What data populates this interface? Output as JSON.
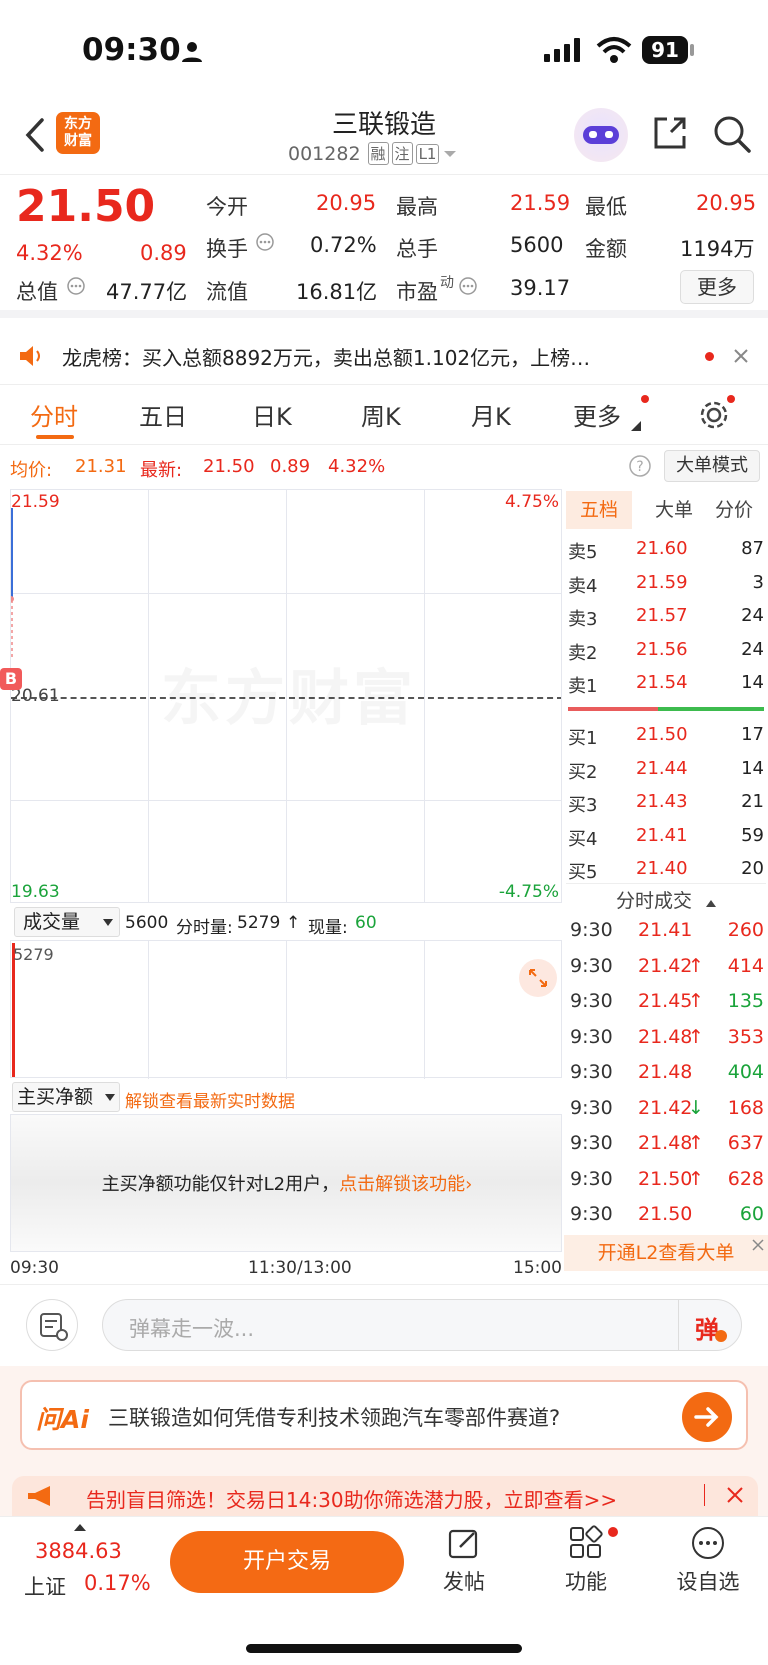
{
  "status_bar": {
    "time": "09:30",
    "battery": "91"
  },
  "header": {
    "logo": "东方\n财富",
    "title": "三联锻造",
    "code": "001282",
    "badges": [
      "融",
      "注",
      "L1"
    ]
  },
  "quote": {
    "price": "21.50",
    "change_pct": "4.32%",
    "change": "0.89",
    "fields": [
      {
        "label": "今开",
        "value": "20.95",
        "color": "red"
      },
      {
        "label": "最高",
        "value": "21.59",
        "color": "red"
      },
      {
        "label": "最低",
        "value": "20.95",
        "color": "red"
      },
      {
        "label": "换手",
        "value": "0.72%",
        "color": "dark"
      },
      {
        "label": "总手",
        "value": "5600",
        "color": "dark"
      },
      {
        "label": "金额",
        "value": "1194万",
        "color": "dark"
      },
      {
        "label": "总值",
        "value": "47.77亿",
        "color": "dark"
      },
      {
        "label": "流值",
        "value": "16.81亿",
        "color": "dark"
      },
      {
        "label": "市盈",
        "value": "39.17",
        "color": "dark"
      }
    ],
    "pe_superscript": "动",
    "more_button": "更多"
  },
  "notice": {
    "text": "龙虎榜：买入总额8892万元，卖出总额1.102亿元，上榜…"
  },
  "tabs": [
    "分时",
    "五日",
    "日K",
    "周K",
    "月K",
    "更多"
  ],
  "active_tab": "分时",
  "chart_header": {
    "avg_label": "均价:",
    "avg_value": "21.31",
    "last_label": "最新:",
    "last_value": "21.50",
    "last_change": "0.89",
    "last_pct": "4.32%",
    "big_order_mode": "大单模式"
  },
  "chart_data": {
    "type": "line",
    "title": "",
    "y_ticks_left": [
      "21.59",
      "20.61",
      "19.63"
    ],
    "y_ticks_right": [
      "4.75%",
      "-4.75%"
    ],
    "x_ticks": [
      "09:30",
      "11:30/13:00",
      "15:00"
    ],
    "ylim": [
      19.63,
      21.59
    ],
    "prev_close": 20.61,
    "series": [
      {
        "x": [
          "09:30"
        ],
        "values": [
          21.5
        ]
      }
    ],
    "watermark": "东方财富",
    "b_marker": "B"
  },
  "volume": {
    "selector": "成交量",
    "total": "5600",
    "minute_label": "分时量:",
    "minute_value": "5279",
    "arrow": "↑",
    "now_label": "现量:",
    "now_value": "60",
    "axis_max": "5279"
  },
  "net_buy": {
    "selector": "主买净额",
    "unlock_hint": "解锁查看最新实时数据",
    "panel_text": "主买净额功能仅针对L2用户，",
    "panel_link": "点击解锁该功能›"
  },
  "orderbook": {
    "tabs": [
      "五档",
      "大单",
      "分价"
    ],
    "asks": [
      {
        "label": "卖5",
        "price": "21.60",
        "vol": "87"
      },
      {
        "label": "卖4",
        "price": "21.59",
        "vol": "3"
      },
      {
        "label": "卖3",
        "price": "21.57",
        "vol": "24"
      },
      {
        "label": "卖2",
        "price": "21.56",
        "vol": "24"
      },
      {
        "label": "卖1",
        "price": "21.54",
        "vol": "14"
      }
    ],
    "bids": [
      {
        "label": "买1",
        "price": "21.50",
        "vol": "17"
      },
      {
        "label": "买2",
        "price": "21.44",
        "vol": "14"
      },
      {
        "label": "买3",
        "price": "21.43",
        "vol": "21"
      },
      {
        "label": "买4",
        "price": "21.41",
        "vol": "59"
      },
      {
        "label": "买5",
        "price": "21.40",
        "vol": "20"
      }
    ]
  },
  "trades": {
    "title": "分时成交",
    "rows": [
      {
        "time": "9:30",
        "price": "21.41",
        "arrow": "",
        "vol": "260",
        "vcolor": "red"
      },
      {
        "time": "9:30",
        "price": "21.42",
        "arrow": "↑",
        "vol": "414",
        "vcolor": "red"
      },
      {
        "time": "9:30",
        "price": "21.45",
        "arrow": "↑",
        "vol": "135",
        "vcolor": "green"
      },
      {
        "time": "9:30",
        "price": "21.48",
        "arrow": "↑",
        "vol": "353",
        "vcolor": "red"
      },
      {
        "time": "9:30",
        "price": "21.48",
        "arrow": "",
        "vol": "404",
        "vcolor": "green"
      },
      {
        "time": "9:30",
        "price": "21.42",
        "arrow": "↓",
        "vol": "168",
        "vcolor": "red"
      },
      {
        "time": "9:30",
        "price": "21.48",
        "arrow": "↑",
        "vol": "637",
        "vcolor": "red"
      },
      {
        "time": "9:30",
        "price": "21.50",
        "arrow": "↑",
        "vol": "628",
        "vcolor": "red"
      },
      {
        "time": "9:30",
        "price": "21.50",
        "arrow": "",
        "vol": "60",
        "vcolor": "green"
      }
    ],
    "l2_banner": "开通L2查看大单"
  },
  "comment": {
    "placeholder": "弹幕走一波...",
    "danmu_btn": "弹"
  },
  "ai": {
    "logo": "问Ai",
    "question": "三联锻造如何凭借专利技术领跑汽车零部件赛道?"
  },
  "promo": {
    "text": "告别盲目筛选！交易日14:30助你筛选潜力股，立即查看>>"
  },
  "bottom_nav": {
    "index_value": "3884.63",
    "index_name": "上证",
    "index_pct": "0.17%",
    "trade_button": "开户交易",
    "items": [
      "发帖",
      "功能",
      "设自选"
    ]
  }
}
